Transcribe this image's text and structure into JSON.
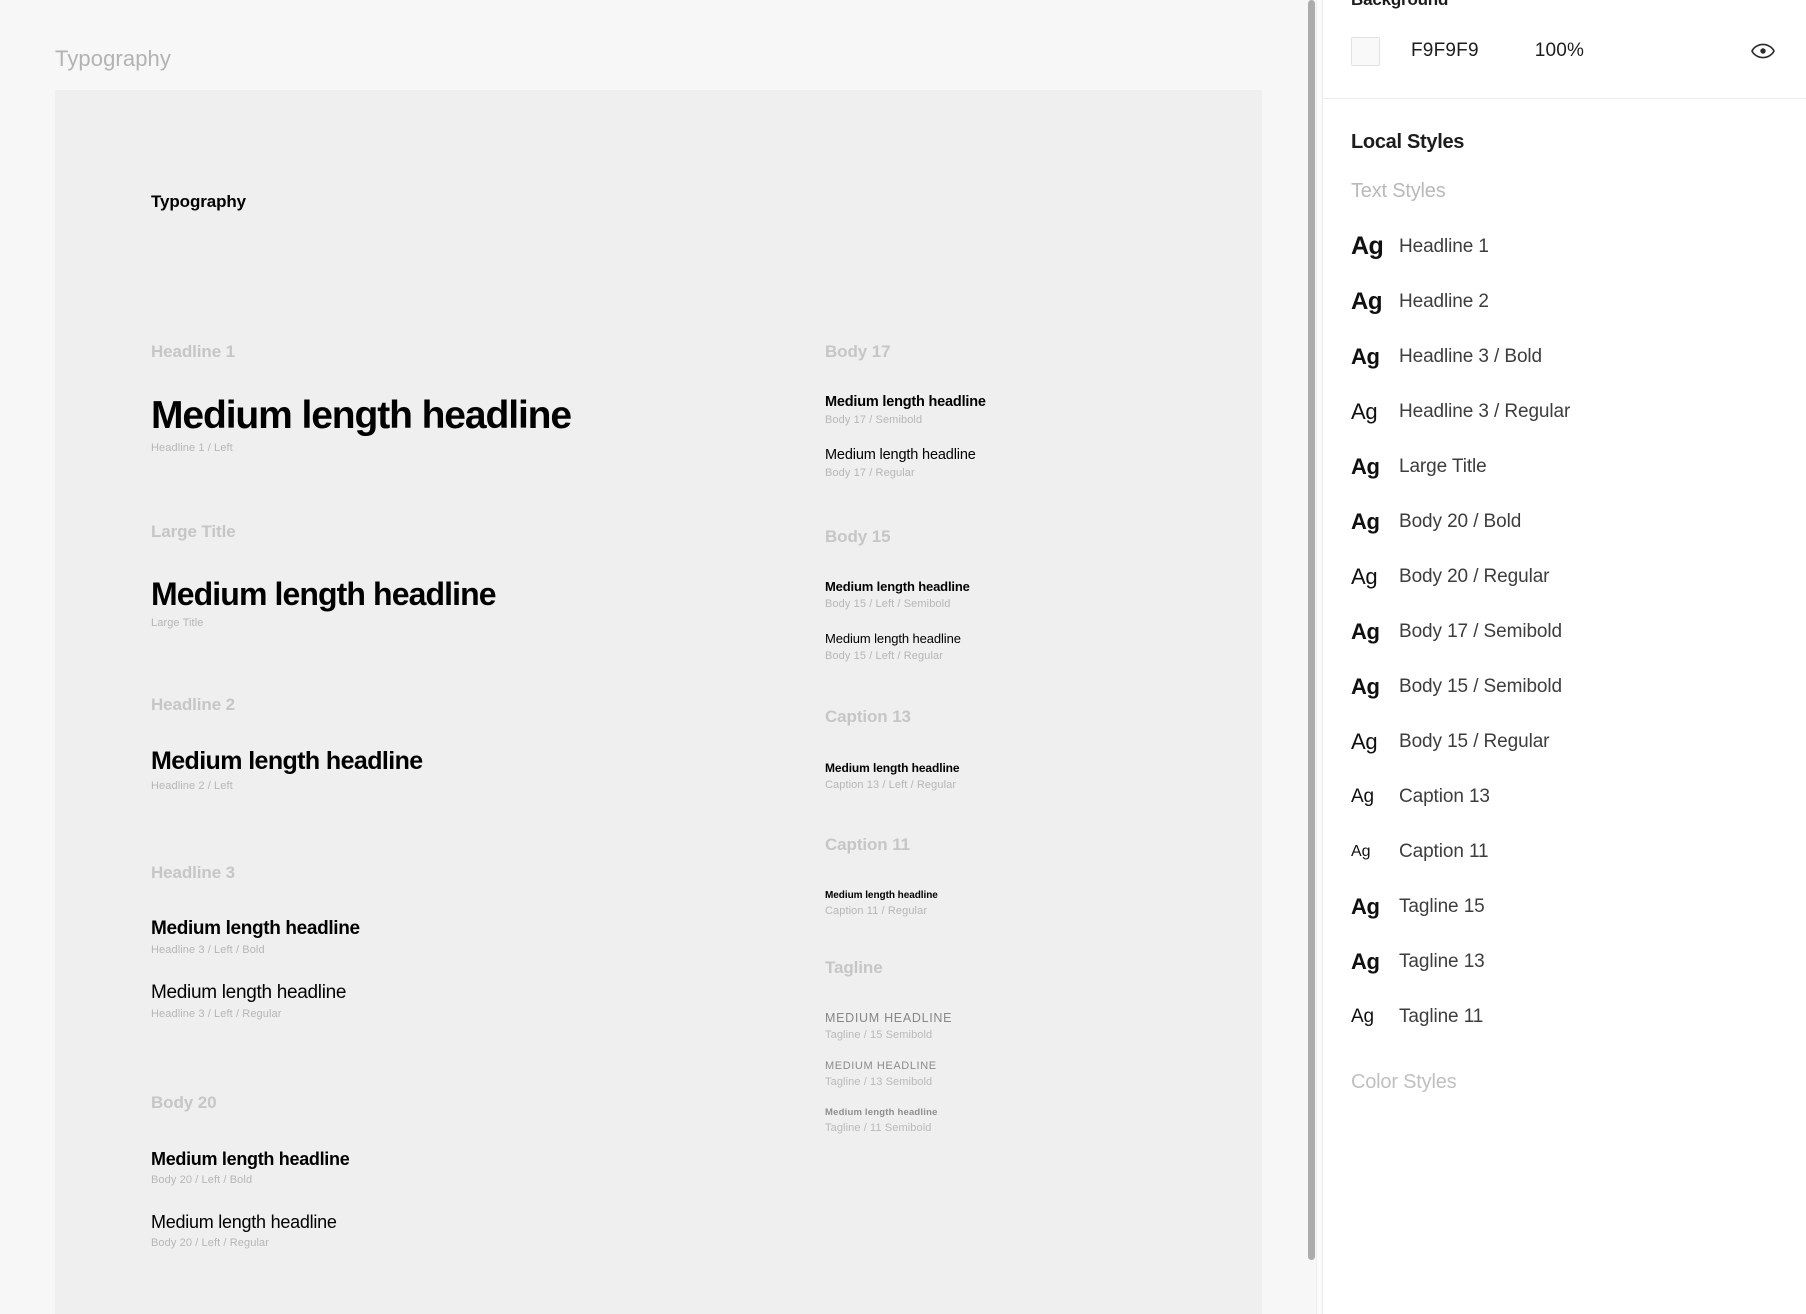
{
  "canvas": {
    "frame_label": "Typography",
    "frame_title": "Typography",
    "sample_text": "Medium length headline",
    "sample_text_upper": "MEDIUM HEADLINE",
    "left_column": [
      {
        "group": "Headline 1",
        "items": [
          {
            "text": "Medium length headline",
            "caption": "Headline 1 / Left"
          }
        ]
      },
      {
        "group": "Large Title",
        "items": [
          {
            "text": "Medium length headline",
            "caption": "Large Title"
          }
        ]
      },
      {
        "group": "Headline 2",
        "items": [
          {
            "text": "Medium length headline",
            "caption": "Headline 2 / Left"
          }
        ]
      },
      {
        "group": "Headline 3",
        "items": [
          {
            "text": "Medium length headline",
            "caption": "Headline 3 / Left / Bold"
          },
          {
            "text": "Medium length headline",
            "caption": "Headline 3 / Left / Regular"
          }
        ]
      },
      {
        "group": "Body 20",
        "items": [
          {
            "text": "Medium length headline",
            "caption": "Body 20 / Left / Bold"
          },
          {
            "text": "Medium length headline",
            "caption": "Body 20 / Left / Regular"
          }
        ]
      }
    ],
    "right_column": [
      {
        "group": "Body 17",
        "items": [
          {
            "text": "Medium length headline",
            "caption": "Body 17 / Semibold"
          },
          {
            "text": "Medium length headline",
            "caption": "Body 17 / Regular"
          }
        ]
      },
      {
        "group": "Body 15",
        "items": [
          {
            "text": "Medium length headline",
            "caption": "Body 15 / Left / Semibold"
          },
          {
            "text": "Medium length headline",
            "caption": "Body 15 / Left / Regular"
          }
        ]
      },
      {
        "group": "Caption 13",
        "items": [
          {
            "text": "Medium length headline",
            "caption": "Caption 13 / Left / Regular"
          }
        ]
      },
      {
        "group": "Caption 11",
        "items": [
          {
            "text": "Medium length headline",
            "caption": "Caption 11 / Regular"
          }
        ]
      },
      {
        "group": "Tagline",
        "items": [
          {
            "text": "MEDIUM HEADLINE",
            "caption": "Tagline / 15 Semibold"
          },
          {
            "text": "MEDIUM HEADLINE",
            "caption": "Tagline / 13 Semibold"
          },
          {
            "text": "Medium length headline",
            "caption": "Tagline / 11 Semibold"
          }
        ]
      }
    ]
  },
  "panel": {
    "background": {
      "heading": "Background",
      "swatch_color": "#F9F9F9",
      "hex": "F9F9F9",
      "opacity": "100%",
      "visibility_icon": "eye-icon"
    },
    "local_styles_heading": "Local Styles",
    "text_styles_heading": "Text Styles",
    "color_styles_heading": "Color Styles",
    "ag_preview": "Ag",
    "text_styles": [
      {
        "preview": "Ag",
        "name": "Headline 1",
        "weight": "bold",
        "size": "xl"
      },
      {
        "preview": "Ag",
        "name": "Headline 2",
        "weight": "bold",
        "size": "lg"
      },
      {
        "preview": "Ag",
        "name": "Headline 3 / Bold",
        "weight": "bold",
        "size": "md"
      },
      {
        "preview": "Ag",
        "name": "Headline 3 / Regular",
        "weight": "regular",
        "size": "mdr"
      },
      {
        "preview": "Ag",
        "name": "Large Title",
        "weight": "bold",
        "size": "md"
      },
      {
        "preview": "Ag",
        "name": "Body 20 / Bold",
        "weight": "bold",
        "size": "md"
      },
      {
        "preview": "Ag",
        "name": "Body 20 / Regular",
        "weight": "regular",
        "size": "mdr"
      },
      {
        "preview": "Ag",
        "name": "Body 17 / Semibold",
        "weight": "bold",
        "size": "md"
      },
      {
        "preview": "Ag",
        "name": "Body 15 / Semibold",
        "weight": "bold",
        "size": "md"
      },
      {
        "preview": "Ag",
        "name": "Body 15 / Regular",
        "weight": "regular",
        "size": "mdr"
      },
      {
        "preview": "Ag",
        "name": "Caption 13",
        "weight": "regular",
        "size": "sm"
      },
      {
        "preview": "Ag",
        "name": "Caption 11",
        "weight": "regular",
        "size": "xs"
      },
      {
        "preview": "Ag",
        "name": "Tagline 15",
        "weight": "bold",
        "size": "md"
      },
      {
        "preview": "Ag",
        "name": "Tagline 13",
        "weight": "bold",
        "size": "md"
      },
      {
        "preview": "Ag",
        "name": "Tagline 11",
        "weight": "regular",
        "size": "sm"
      }
    ]
  },
  "colors": {
    "canvas_bg": "#F7F7F7",
    "frame_bg": "#EFEFEF",
    "panel_bg": "#FFFFFF",
    "muted_text": "#B9B9B9",
    "body_text": "#3D3D3D",
    "heading_text": "#1C1C1C",
    "scrollbar": "#ACACAC"
  }
}
